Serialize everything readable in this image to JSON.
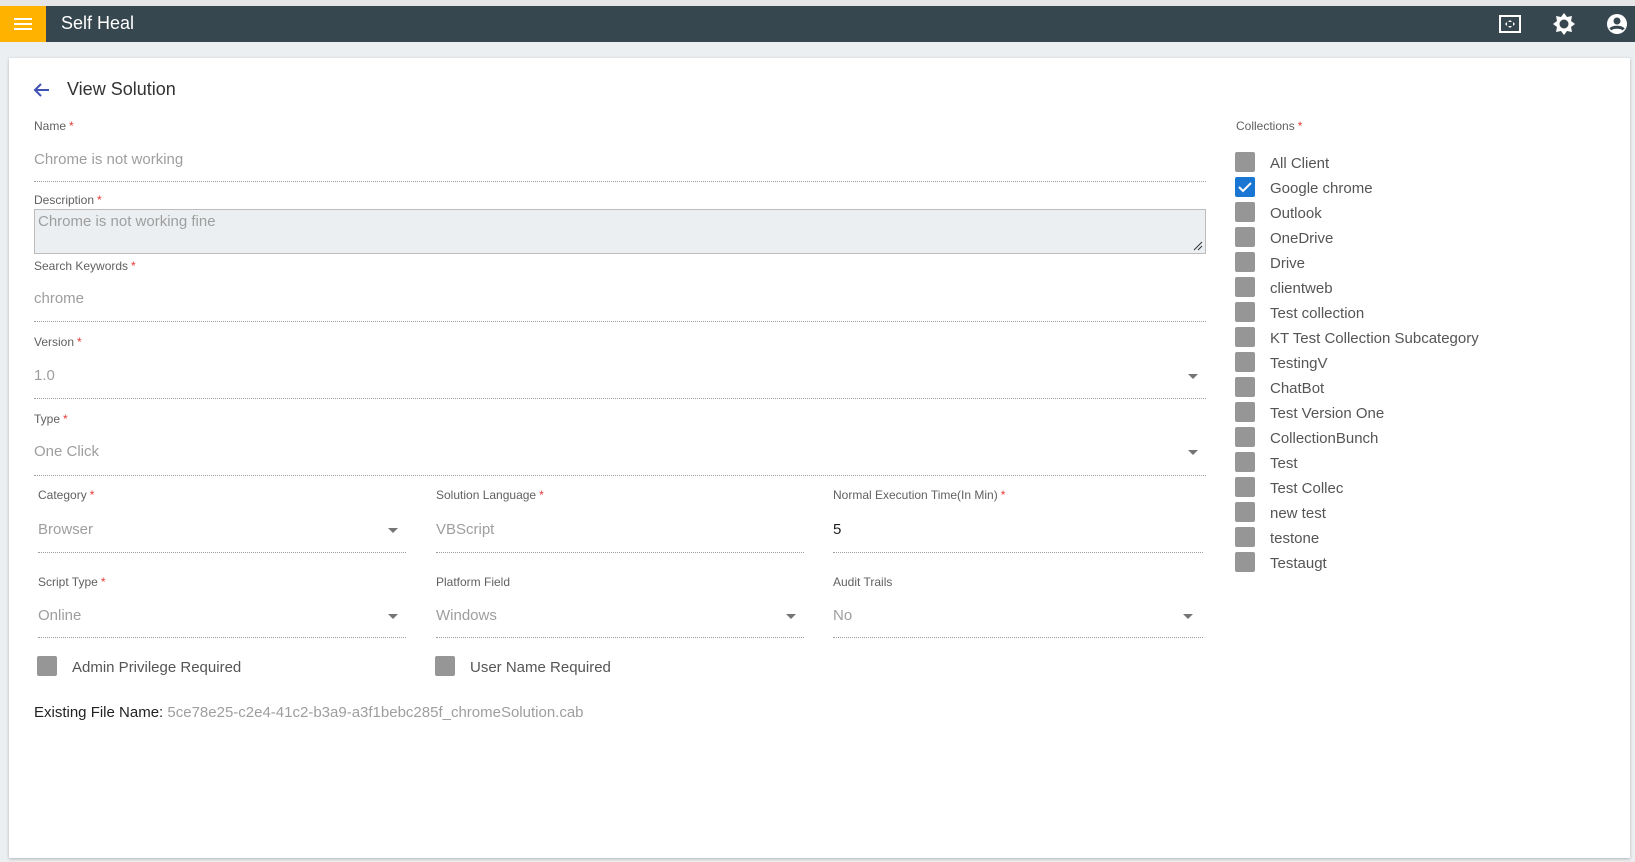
{
  "header": {
    "title": "Self Heal",
    "icons": [
      "menu-icon",
      "fullscreen-icon",
      "settings-icon",
      "account-icon"
    ]
  },
  "page": {
    "title": "View Solution"
  },
  "form": {
    "name": {
      "label": "Name",
      "value": "Chrome is not working"
    },
    "description": {
      "label": "Description",
      "value": "Chrome is not working fine"
    },
    "keywords": {
      "label": "Search Keywords",
      "value": "chrome"
    },
    "version": {
      "label": "Version",
      "value": "1.0"
    },
    "type": {
      "label": "Type",
      "value": "One Click"
    },
    "category": {
      "label": "Category",
      "value": "Browser"
    },
    "language": {
      "label": "Solution Language",
      "value": "VBScript"
    },
    "exec_time": {
      "label": "Normal Execution Time(In Min)",
      "value": "5"
    },
    "script_type": {
      "label": "Script Type",
      "value": "Online"
    },
    "platform": {
      "label": "Platform Field",
      "value": "Windows"
    },
    "audit": {
      "label": "Audit Trails",
      "value": "No"
    },
    "admin_priv": {
      "label": "Admin Privilege Required",
      "checked": false
    },
    "user_name": {
      "label": "User Name Required",
      "checked": false
    },
    "file": {
      "label": "Existing File Name:",
      "value": "5ce78e25-c2e4-41c2-b3a9-a3f1bebc285f_chromeSolution.cab"
    },
    "required_mark": "*"
  },
  "collections": {
    "label": "Collections",
    "items": [
      {
        "label": "All Client",
        "checked": false
      },
      {
        "label": "Google chrome",
        "checked": true
      },
      {
        "label": "Outlook",
        "checked": false
      },
      {
        "label": "OneDrive",
        "checked": false
      },
      {
        "label": "Drive",
        "checked": false
      },
      {
        "label": "clientweb",
        "checked": false
      },
      {
        "label": "Test collection",
        "checked": false
      },
      {
        "label": "KT Test Collection Subcategory",
        "checked": false
      },
      {
        "label": "TestingV",
        "checked": false
      },
      {
        "label": "ChatBot",
        "checked": false
      },
      {
        "label": "Test Version One",
        "checked": false
      },
      {
        "label": "CollectionBunch",
        "checked": false
      },
      {
        "label": "Test",
        "checked": false
      },
      {
        "label": "Test Collec",
        "checked": false
      },
      {
        "label": "new test",
        "checked": false
      },
      {
        "label": "testone",
        "checked": false
      },
      {
        "label": "Testaugt",
        "checked": false
      }
    ]
  }
}
